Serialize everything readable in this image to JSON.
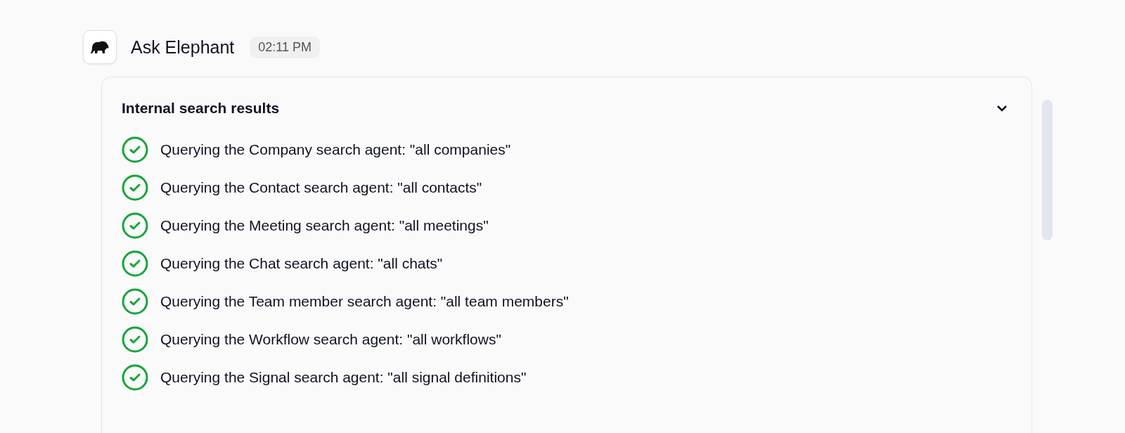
{
  "message": {
    "sender": "Ask Elephant",
    "time": "02:11 PM"
  },
  "panel": {
    "title": "Internal search results",
    "expanded": true,
    "steps": [
      {
        "text": "Querying the Company search agent: \"all companies\"",
        "done": true
      },
      {
        "text": "Querying the Contact search agent: \"all contacts\"",
        "done": true
      },
      {
        "text": "Querying the Meeting search agent: \"all meetings\"",
        "done": true
      },
      {
        "text": "Querying the Chat search agent: \"all chats\"",
        "done": true
      },
      {
        "text": "Querying the Team member search agent: \"all team members\"",
        "done": true
      },
      {
        "text": "Querying the Workflow search agent: \"all workflows\"",
        "done": true
      },
      {
        "text": "Querying the Signal search agent: \"all signal definitions\"",
        "done": true
      }
    ]
  }
}
